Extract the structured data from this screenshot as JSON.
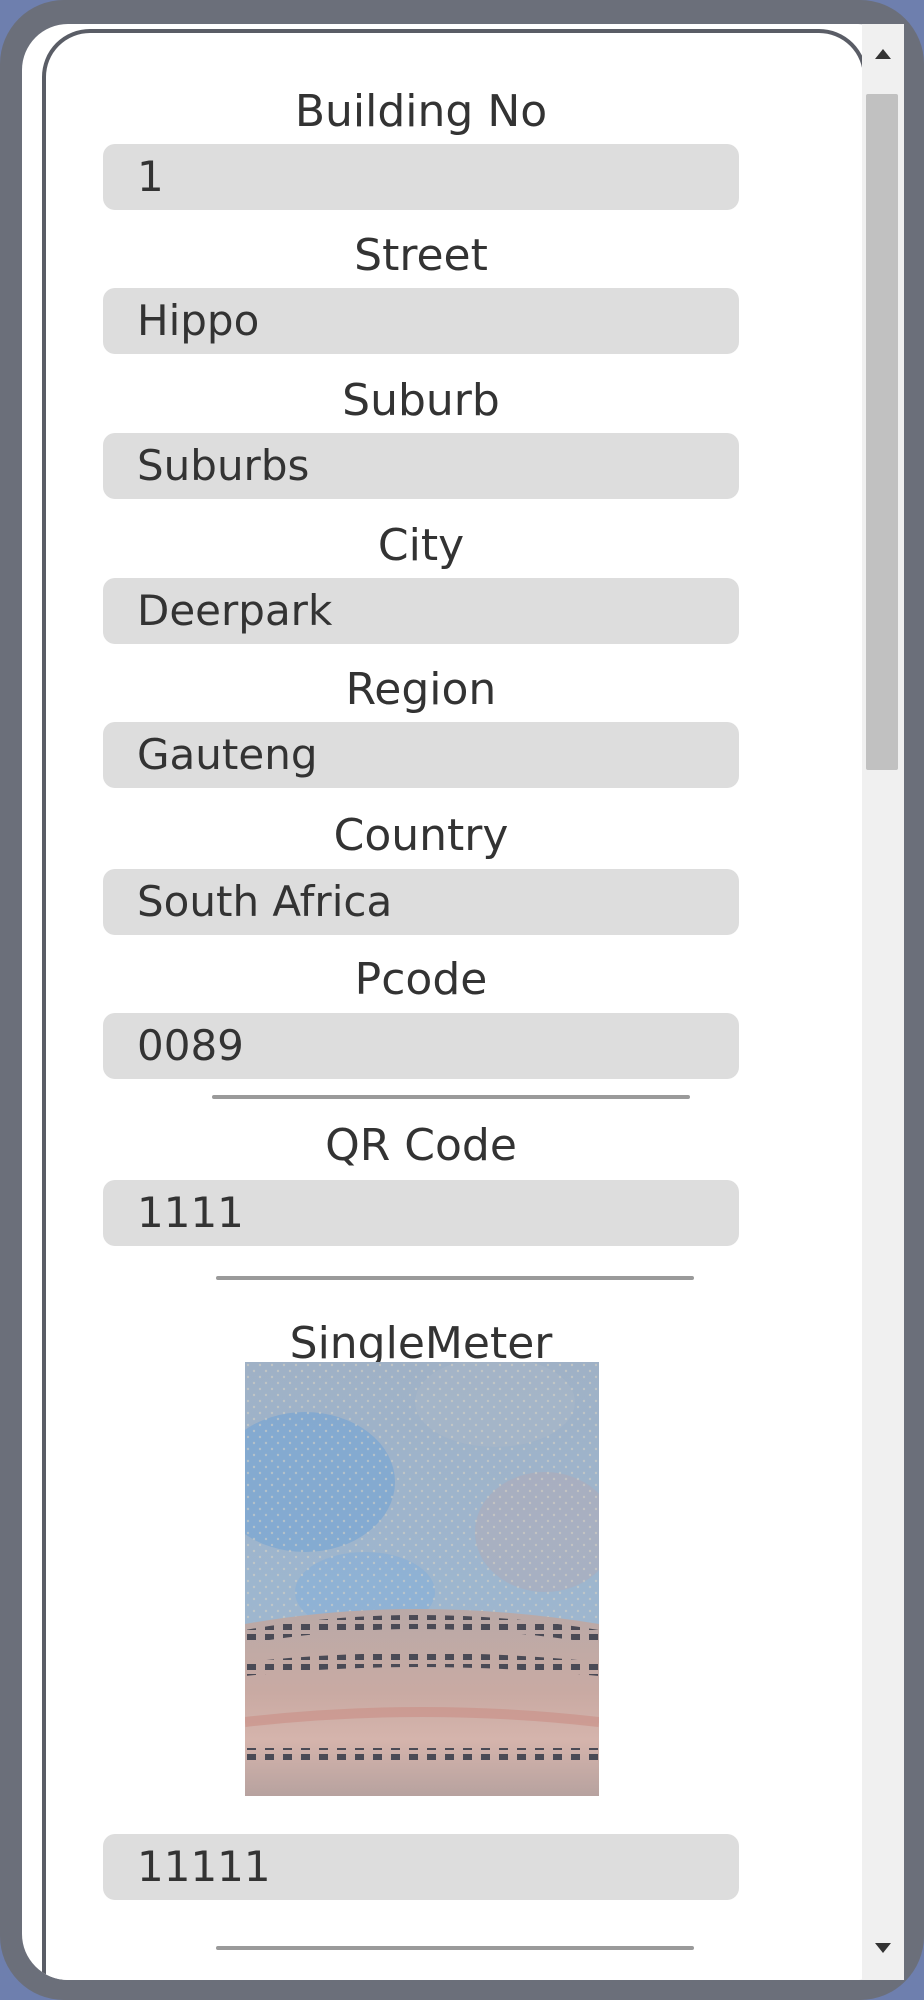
{
  "form": {
    "fields": [
      {
        "label": "Building No",
        "value": "1"
      },
      {
        "label": "Street",
        "value": "Hippo"
      },
      {
        "label": "Suburb",
        "value": "Suburbs"
      },
      {
        "label": "City",
        "value": "Deerpark"
      },
      {
        "label": "Region",
        "value": "Gauteng"
      },
      {
        "label": "Country",
        "value": "South Africa"
      },
      {
        "label": "Pcode",
        "value": "0089"
      }
    ],
    "qr": {
      "label": "QR Code",
      "value": "1111"
    },
    "meter": {
      "label": "SingleMeter",
      "value": "11111",
      "image": "meter-photo"
    }
  },
  "scrollbar": {
    "up_icon": "up-arrow-icon",
    "down_icon": "down-arrow-icon",
    "position": 0.0
  },
  "colors": {
    "background": "#6e7fae",
    "frame": "#6b6f7a",
    "input_fill": "#dddddd",
    "text": "#333333"
  }
}
